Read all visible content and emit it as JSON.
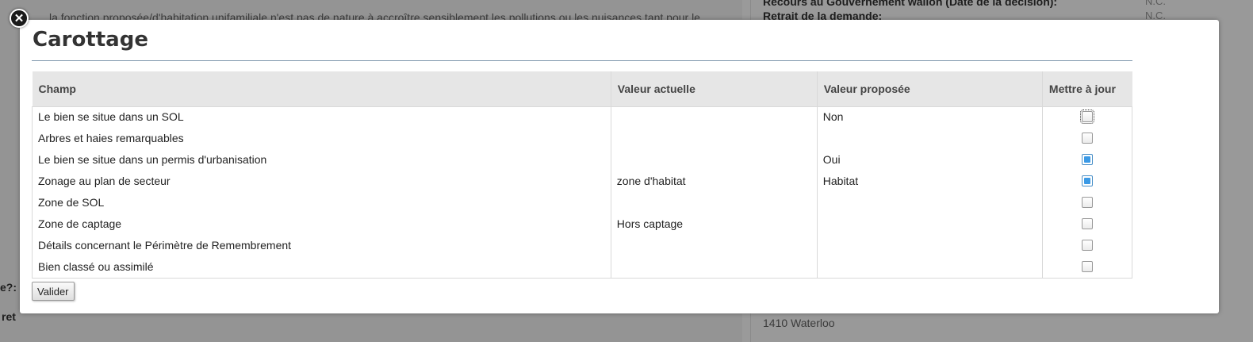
{
  "background": {
    "top_text": "la fonction proposée/d'habitation unifamiliale n'est pas de nature à accroître sensiblement les pollutions ou les nuisances tant pour le",
    "right_heading_1": "Recours au Gouvernement wallon (Date de la décision):",
    "right_heading_2": "Retrait de la demande:",
    "right_value_1": "N.C.",
    "right_value_2": "N.C.",
    "left_fragment_1": "e?:",
    "left_fragment_2": "ret",
    "right_address": "1410 Waterloo"
  },
  "modal": {
    "title": "Carottage",
    "close_icon": "close-icon",
    "columns": {
      "champ": "Champ",
      "actuelle": "Valeur actuelle",
      "proposee": "Valeur proposée",
      "maj": "Mettre à jour"
    },
    "rows": [
      {
        "champ": "Le bien se situe dans un SOL",
        "actuelle": "",
        "proposee": "Non",
        "checked": false
      },
      {
        "champ": "Arbres et haies remarquables",
        "actuelle": "",
        "proposee": "",
        "checked": false
      },
      {
        "champ": "Le bien se situe dans un permis d'urbanisation",
        "actuelle": "",
        "proposee": "Oui",
        "checked": true
      },
      {
        "champ": "Zonage au plan de secteur",
        "actuelle": "zone d'habitat",
        "proposee": "Habitat",
        "checked": true
      },
      {
        "champ": "Zone de SOL",
        "actuelle": "",
        "proposee": "",
        "checked": false
      },
      {
        "champ": "Zone de captage",
        "actuelle": "Hors captage",
        "proposee": "",
        "checked": false
      },
      {
        "champ": "Détails concernant le Périmètre de Remembrement",
        "actuelle": "",
        "proposee": "",
        "checked": false
      },
      {
        "champ": "Bien classé ou assimilé",
        "actuelle": "",
        "proposee": "",
        "checked": false
      }
    ],
    "submit_label": "Valider"
  },
  "colors": {
    "title_rule": "#7f97ad",
    "header_bg": "#e6e6e6",
    "checkbox_checked": "#3b9ae6"
  }
}
